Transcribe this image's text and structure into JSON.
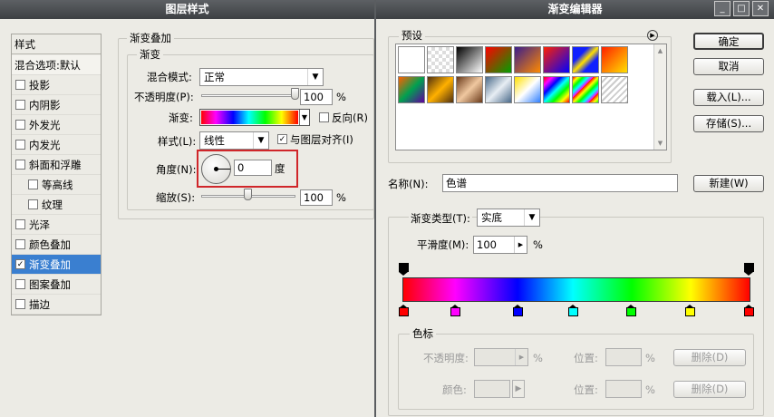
{
  "layer_style": {
    "title": "图层样式",
    "styles_header": "样式",
    "blend_options": "混合选项:默认",
    "items": [
      {
        "label": "投影",
        "checked": false
      },
      {
        "label": "内阴影",
        "checked": false
      },
      {
        "label": "外发光",
        "checked": false
      },
      {
        "label": "内发光",
        "checked": false
      },
      {
        "label": "斜面和浮雕",
        "checked": false
      },
      {
        "label": "等高线",
        "checked": false
      },
      {
        "label": "纹理",
        "checked": false
      },
      {
        "label": "光泽",
        "checked": false
      },
      {
        "label": "颜色叠加",
        "checked": false
      },
      {
        "label": "渐变叠加",
        "checked": true
      },
      {
        "label": "图案叠加",
        "checked": false
      },
      {
        "label": "描边",
        "checked": false
      }
    ],
    "group_title": "渐变叠加",
    "subgroup_title": "渐变",
    "blend_mode_label": "混合模式:",
    "blend_mode": "正常",
    "opacity_label": "不透明度(P):",
    "opacity": "100",
    "opacity_unit": "%",
    "opacity_level": 1.0,
    "gradient_label": "渐变:",
    "reverse_label": "反向(R)",
    "reverse_checked": false,
    "style_label": "样式(L):",
    "style": "线性",
    "align_label": "与图层对齐(I)",
    "align_checked": true,
    "angle_label": "角度(N):",
    "angle": "0",
    "angle_unit": "度",
    "scale_label": "缩放(S):",
    "scale": "100",
    "scale_unit": "%",
    "scale_level": 0.5
  },
  "gradient_editor": {
    "title": "渐变编辑器",
    "presets_title": "预设",
    "ok": "确定",
    "cancel": "取消",
    "load": "载入(L)...",
    "save": "存储(S)...",
    "name_label": "名称(N):",
    "name_value": "色谱",
    "new_button": "新建(W)",
    "type_label": "渐变类型(T):",
    "type_value": "实底",
    "smooth_label": "平滑度(M):",
    "smooth_value": "100",
    "smooth_unit": "%",
    "stops_title": "色标",
    "opacity_label": "不透明度:",
    "position_label": "位置:",
    "percent": "%",
    "delete_label": "删除(D)",
    "color_label": "颜色:",
    "color_stops": [
      "#ff0000",
      "#ff00ff",
      "#0000ff",
      "#00ffff",
      "#00ff00",
      "#ffff00",
      "#ff0000"
    ]
  },
  "colors": {
    "title_bar": "#45484b",
    "selected": "#3a7fd0",
    "highlight_box": "#d0262a"
  }
}
